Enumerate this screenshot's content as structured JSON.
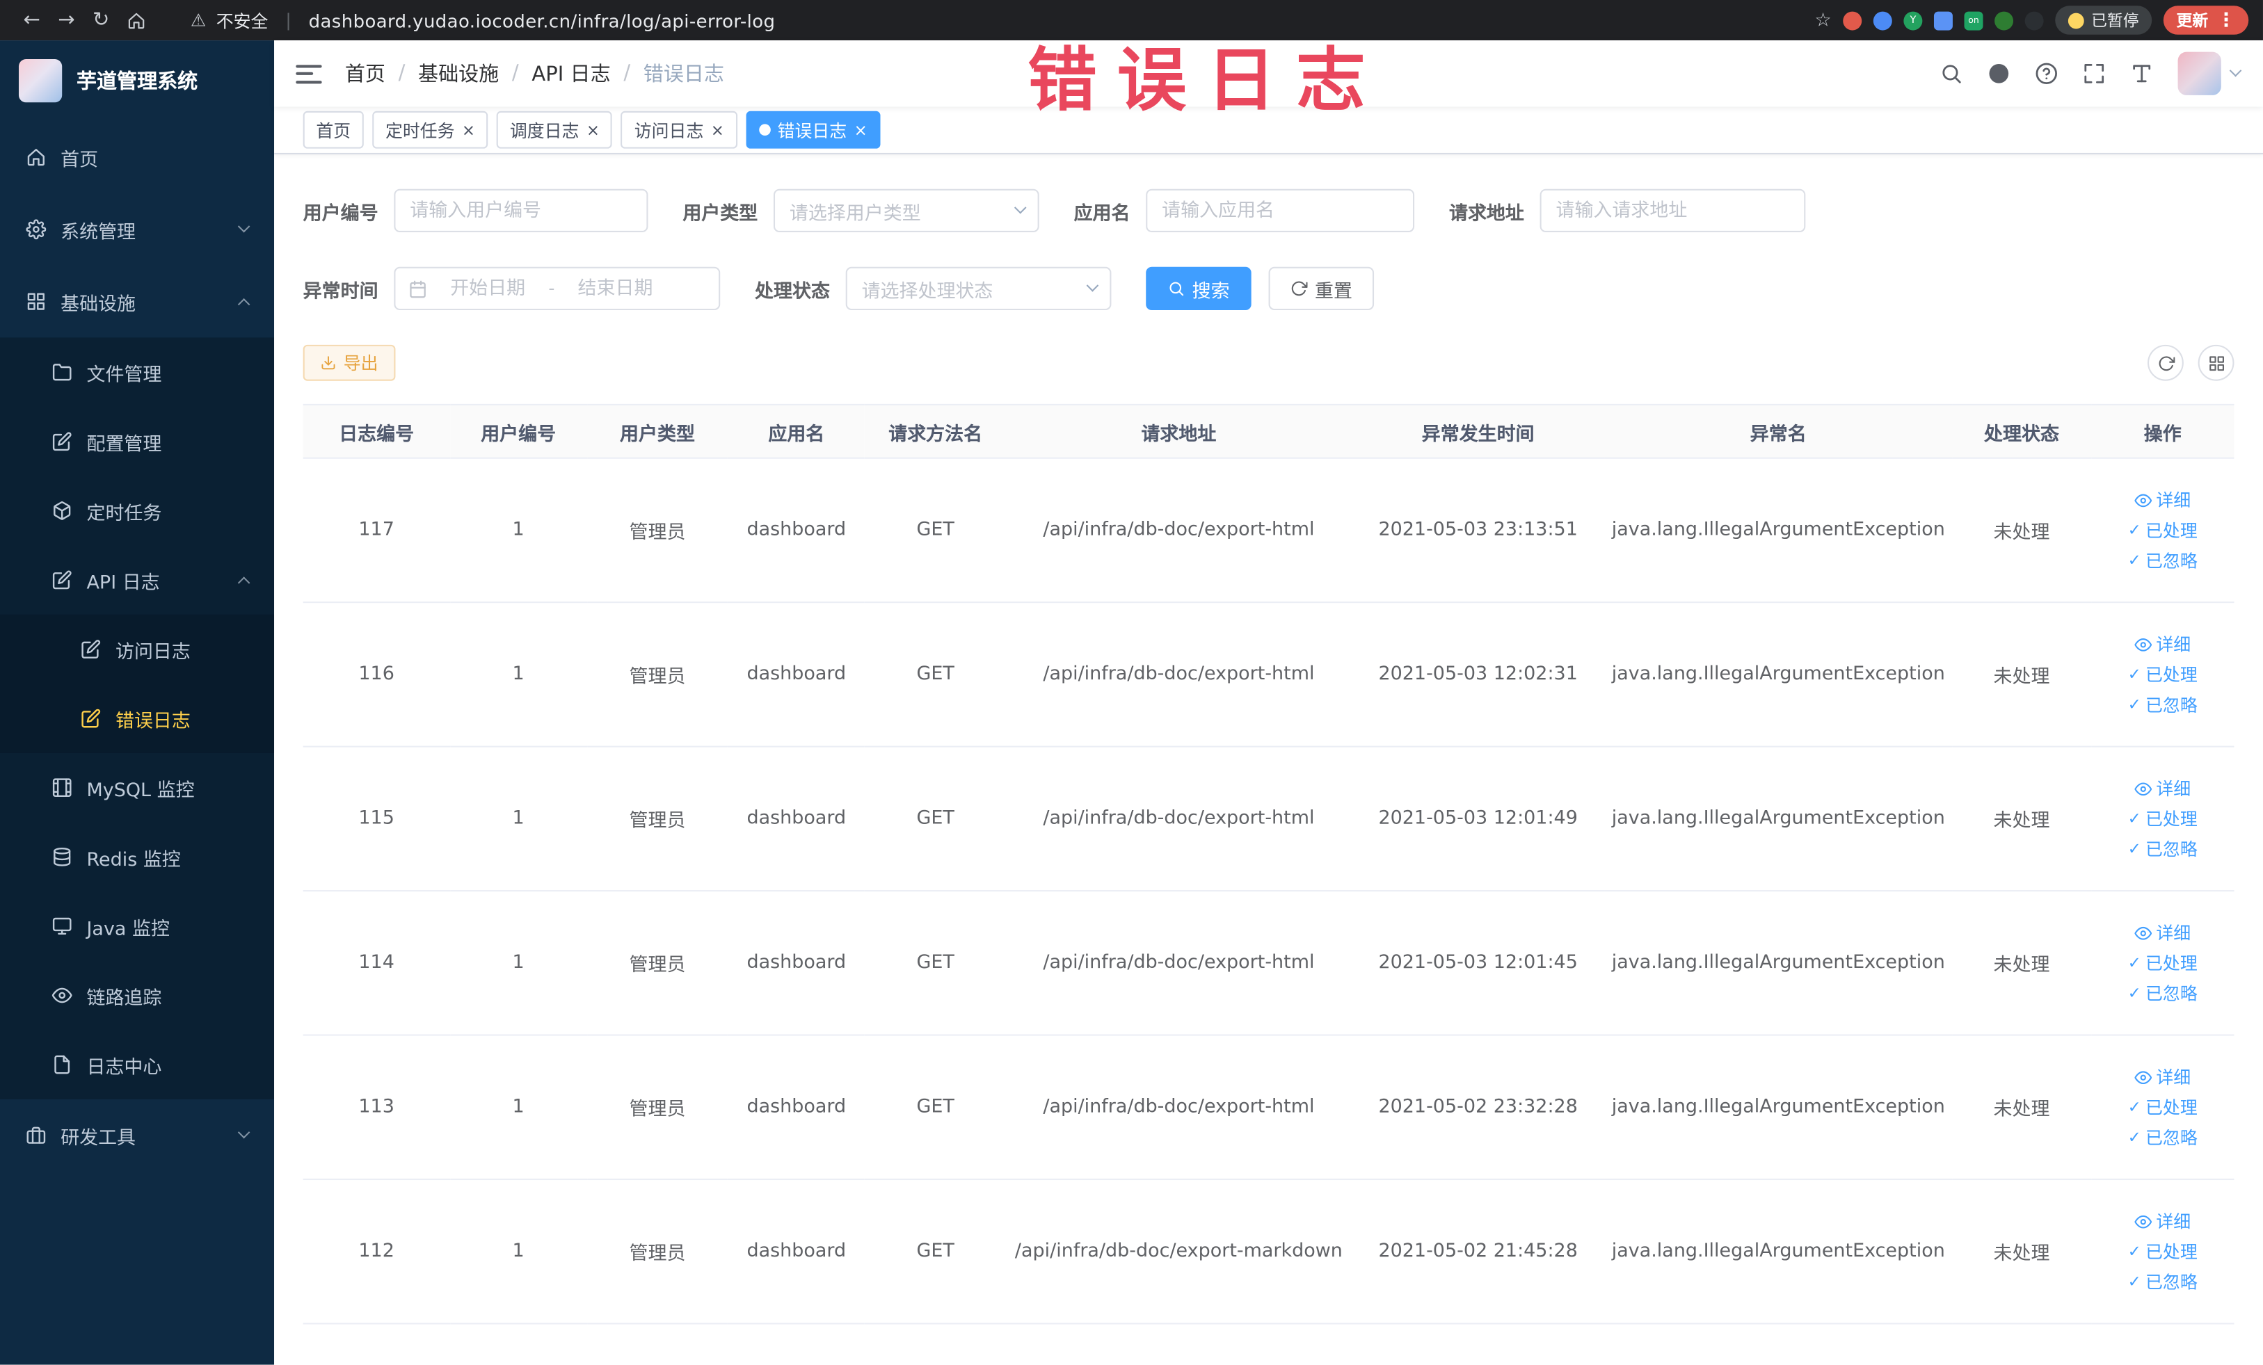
{
  "colors": {
    "primary": "#409eff",
    "sidebar_bg": "#0e2a43",
    "sidebar_active_text": "#ffd04b",
    "watermark_red": "#e9475d",
    "warning": "#e6a23c",
    "active_tab_bg": "#409eff",
    "update_pill": "#de5449"
  },
  "browser": {
    "security_label": "不安全",
    "url": "dashboard.yudao.iocoder.cn/infra/log/api-error-log",
    "extension_badge": "on",
    "paused_label": "已暂停",
    "update_label": "更新"
  },
  "sidebar": {
    "logo_title": "芋道管理系统",
    "items": [
      {
        "label": "首页"
      },
      {
        "label": "系统管理"
      },
      {
        "label": "基础设施"
      },
      {
        "label": "文件管理"
      },
      {
        "label": "配置管理"
      },
      {
        "label": "定时任务"
      },
      {
        "label": "API 日志"
      },
      {
        "label": "访问日志"
      },
      {
        "label": "错误日志"
      },
      {
        "label": "MySQL 监控"
      },
      {
        "label": "Redis 监控"
      },
      {
        "label": "Java 监控"
      },
      {
        "label": "链路追踪"
      },
      {
        "label": "日志中心"
      },
      {
        "label": "研发工具"
      }
    ]
  },
  "header": {
    "breadcrumb": [
      "首页",
      "基础设施",
      "API 日志",
      "错误日志"
    ],
    "watermark": "错误日志"
  },
  "tabs": [
    {
      "label": "首页"
    },
    {
      "label": "定时任务"
    },
    {
      "label": "调度日志"
    },
    {
      "label": "访问日志"
    },
    {
      "label": "错误日志"
    }
  ],
  "filters": {
    "user_id": {
      "label": "用户编号",
      "placeholder": "请输入用户编号"
    },
    "user_type": {
      "label": "用户类型",
      "placeholder": "请选择用户类型"
    },
    "app_name": {
      "label": "应用名",
      "placeholder": "请输入应用名"
    },
    "request_url": {
      "label": "请求地址",
      "placeholder": "请输入请求地址"
    },
    "exception_time": {
      "label": "异常时间",
      "start_placeholder": "开始日期",
      "separator": "-",
      "end_placeholder": "结束日期"
    },
    "process_status": {
      "label": "处理状态",
      "placeholder": "请选择处理状态"
    },
    "search_label": "搜索",
    "reset_label": "重置"
  },
  "toolbar": {
    "export_label": "导出"
  },
  "table": {
    "columns": [
      "日志编号",
      "用户编号",
      "用户类型",
      "应用名",
      "请求方法名",
      "请求地址",
      "异常发生时间",
      "异常名",
      "处理状态",
      "操作"
    ],
    "actions": [
      "详细",
      "已处理",
      "已忽略"
    ],
    "rows": [
      {
        "id": "117",
        "user_id": "1",
        "user_type": "管理员",
        "app": "dashboard",
        "method": "GET",
        "url": "/api/infra/db-doc/export-html",
        "time": "2021-05-03 23:13:51",
        "exception": "java.lang.IllegalArgumentException",
        "status": "未处理"
      },
      {
        "id": "116",
        "user_id": "1",
        "user_type": "管理员",
        "app": "dashboard",
        "method": "GET",
        "url": "/api/infra/db-doc/export-html",
        "time": "2021-05-03 12:02:31",
        "exception": "java.lang.IllegalArgumentException",
        "status": "未处理"
      },
      {
        "id": "115",
        "user_id": "1",
        "user_type": "管理员",
        "app": "dashboard",
        "method": "GET",
        "url": "/api/infra/db-doc/export-html",
        "time": "2021-05-03 12:01:49",
        "exception": "java.lang.IllegalArgumentException",
        "status": "未处理"
      },
      {
        "id": "114",
        "user_id": "1",
        "user_type": "管理员",
        "app": "dashboard",
        "method": "GET",
        "url": "/api/infra/db-doc/export-html",
        "time": "2021-05-03 12:01:45",
        "exception": "java.lang.IllegalArgumentException",
        "status": "未处理"
      },
      {
        "id": "113",
        "user_id": "1",
        "user_type": "管理员",
        "app": "dashboard",
        "method": "GET",
        "url": "/api/infra/db-doc/export-html",
        "time": "2021-05-02 23:32:28",
        "exception": "java.lang.IllegalArgumentException",
        "status": "未处理"
      },
      {
        "id": "112",
        "user_id": "1",
        "user_type": "管理员",
        "app": "dashboard",
        "method": "GET",
        "url": "/api/infra/db-doc/export-markdown",
        "time": "2021-05-02 21:45:28",
        "exception": "java.lang.IllegalArgumentException",
        "status": "未处理"
      }
    ]
  }
}
